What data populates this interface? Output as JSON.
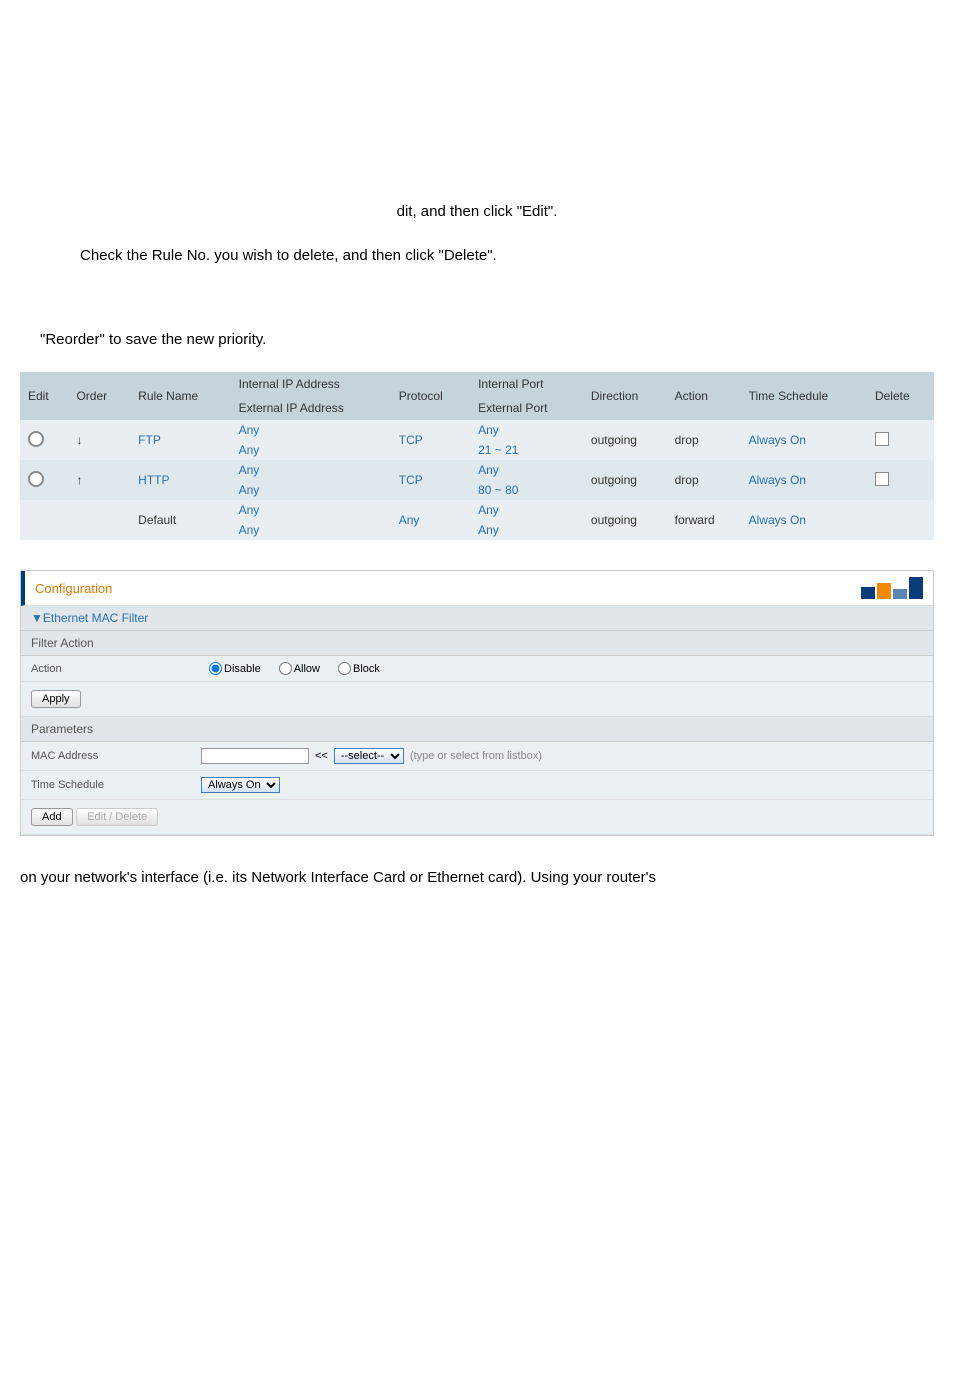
{
  "instruction1": "dit, and then click \"Edit\".",
  "instruction2": "Check the Rule No. you wish to delete, and then click \"Delete\".",
  "reorder_text": "\"Reorder\" to save the new priority.",
  "table": {
    "headers": {
      "edit": "Edit",
      "order": "Order",
      "rulename": "Rule Name",
      "intip": "Internal IP Address",
      "extip": "External IP Address",
      "protocol": "Protocol",
      "intport": "Internal Port",
      "extport": "External Port",
      "direction": "Direction",
      "action": "Action",
      "time": "Time Schedule",
      "delete": "Delete"
    },
    "rows": [
      {
        "order_arrow": "↓",
        "rulename": "FTP",
        "intip": "Any",
        "extip": "Any",
        "protocol": "TCP",
        "intport": "Any",
        "extport": "21 ~ 21",
        "direction": "outgoing",
        "action": "drop",
        "time": "Always On"
      },
      {
        "order_arrow": "↑",
        "rulename": "HTTP",
        "intip": "Any",
        "extip": "Any",
        "protocol": "TCP",
        "intport": "Any",
        "extport": "80 ~ 80",
        "direction": "outgoing",
        "action": "drop",
        "time": "Always On"
      },
      {
        "order_arrow": "",
        "rulename": "Default",
        "intip": "Any",
        "extip": "Any",
        "protocol": "Any",
        "intport": "Any",
        "extport": "Any",
        "direction": "outgoing",
        "action": "forward",
        "time": "Always On"
      }
    ]
  },
  "config": {
    "title": "Configuration",
    "section": "▼Ethernet MAC Filter",
    "filter_action": "Filter Action",
    "action_label": "Action",
    "radio_disable": "Disable",
    "radio_allow": "Allow",
    "radio_block": "Block",
    "apply": "Apply",
    "parameters": "Parameters",
    "mac_address": "MAC Address",
    "select_placeholder": "--select--",
    "mac_hint": "(type or select from listbox)",
    "time_schedule": "Time Schedule",
    "time_value": "Always On",
    "add": "Add",
    "edit_delete": "Edit / Delete",
    "ll": "<<"
  },
  "bottom_text": "on your network's interface (i.e. its Network Interface Card or Ethernet card). Using your router's"
}
